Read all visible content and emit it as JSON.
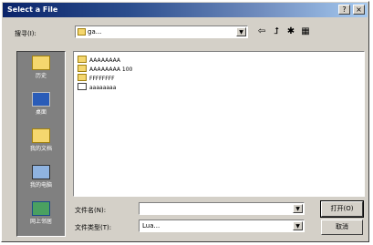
{
  "window": {
    "title": "Select a File",
    "close_glyph": "×",
    "help_glyph": "?"
  },
  "toolbar": {
    "look_in_label": "搜寻(I):",
    "look_in_value": "ga...",
    "back_icon": "back-arrow-icon",
    "up_icon": "up-folder-icon",
    "new_folder_icon": "new-folder-icon",
    "view_menu_icon": "view-menu-icon"
  },
  "places": [
    {
      "label": "历史",
      "icon": "history-icon"
    },
    {
      "label": "桌面",
      "icon": "desktop-icon"
    },
    {
      "label": "我的文档",
      "icon": "my-documents-icon"
    },
    {
      "label": "我的电脑",
      "icon": "my-computer-icon"
    },
    {
      "label": "网上邻居",
      "icon": "network-places-icon"
    }
  ],
  "files": [
    {
      "name": "AAAAAAAA",
      "type": "folder"
    },
    {
      "name": "AAAAAAAA 100",
      "type": "folder"
    },
    {
      "name": "FFFFFFFF",
      "type": "folder"
    },
    {
      "name": "aaaaaaaa",
      "type": "document"
    }
  ],
  "footer": {
    "filename_label": "文件名(N):",
    "filename_value": "",
    "filetype_label": "文件类型(T):",
    "filetype_value": "Lua...",
    "open_button": "打开(O)",
    "cancel_button": "取消"
  }
}
